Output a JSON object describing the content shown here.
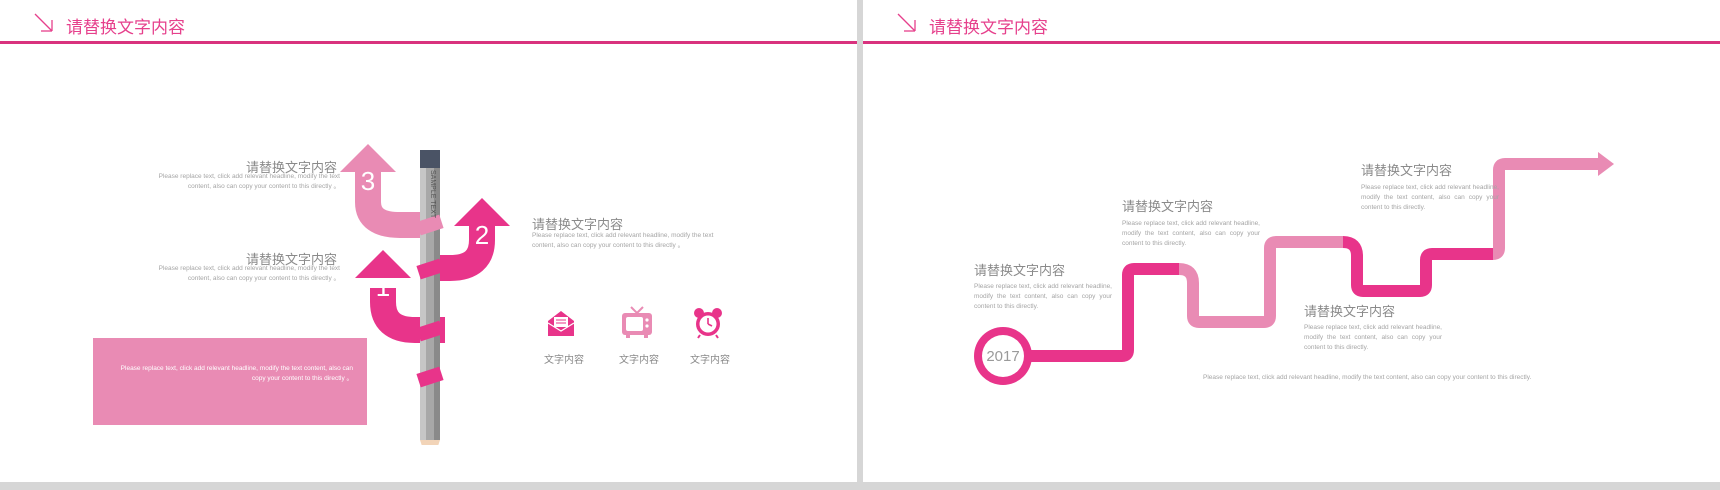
{
  "colors": {
    "accent": "#e6408c",
    "magenta": "#e8348a",
    "light_pink": "#e98bb4",
    "gray_text": "#8a8a8a"
  },
  "left_slide": {
    "title": "请替换文字内容",
    "item3": {
      "number": "3",
      "heading": "请替换文字内容",
      "text": "Please replace text, click add relevant headline, modify the text content, also can copy your content to this directly 。"
    },
    "item1": {
      "number": "1",
      "heading": "请替换文字内容",
      "text": "Please replace text, click add relevant headline, modify the text content, also can copy your content to this directly 。"
    },
    "item2": {
      "number": "2",
      "heading": "请替换文字内容",
      "text": "Please replace text, click add relevant headline, modify the text content, also can copy your content to this directly 。"
    },
    "pencil_label": "SAMPLE TEXT",
    "box_text": "Please replace text, click add relevant headline, modify the text content, also can copy your content to this directly 。",
    "icons": [
      {
        "name": "mail-icon",
        "label": "文字内容"
      },
      {
        "name": "tv-icon",
        "label": "文字内容"
      },
      {
        "name": "alarm-clock-icon",
        "label": "文字内容"
      }
    ]
  },
  "right_slide": {
    "title": "请替换文字内容",
    "year": "2017",
    "steps": [
      {
        "heading": "请替换文字内容",
        "text": "Please replace text, click add relevant headline, modify the text content, also can copy your content to this directly."
      },
      {
        "heading": "请替换文字内容",
        "text": "Please replace text, click add relevant headline, modify the text content, also can copy your content to this directly."
      },
      {
        "heading": "请替换文字内容",
        "text": "Please replace text, click add relevant headline, modify the text content, also can copy your content to this directly."
      },
      {
        "heading": "请替换文字内容",
        "text": "Please replace text, click add relevant headline, modify the text content, also can copy your content to this directly."
      }
    ],
    "footer_text": "Please replace text, click add relevant headline, modify the text content, also can copy your content to this directly."
  }
}
